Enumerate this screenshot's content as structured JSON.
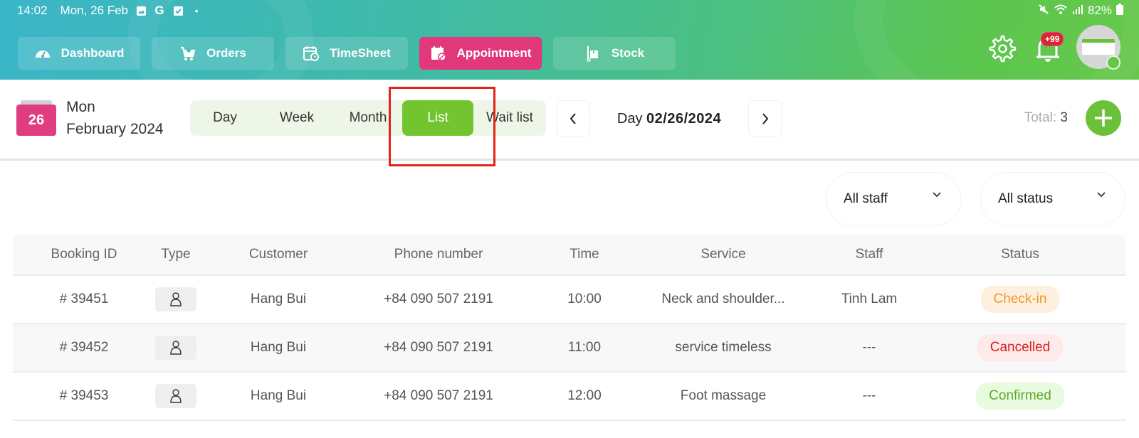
{
  "status_bar": {
    "time": "14:02",
    "date": "Mon, 26 Feb",
    "left_icons": [
      "image-icon",
      "google-icon",
      "checkbox-icon",
      "dot-icon"
    ],
    "right_icons": [
      "mute-icon",
      "wifi-icon",
      "signal-icon",
      "battery-icon"
    ],
    "battery": "82%"
  },
  "nav": {
    "items": [
      {
        "label": "Dashboard",
        "icon": "dashboard-gauge-icon",
        "active": false
      },
      {
        "label": "Orders",
        "icon": "cart-icon",
        "active": false
      },
      {
        "label": "TimeSheet",
        "icon": "calendar-clock-icon",
        "active": false
      },
      {
        "label": "Appointment",
        "icon": "calendar-check-icon",
        "active": true
      },
      {
        "label": "Stock",
        "icon": "hand-truck-icon",
        "active": false
      }
    ],
    "notification_badge": "+99"
  },
  "header": {
    "calendar_day": "26",
    "weekday": "Mon",
    "month_year": "February 2024",
    "view_tabs": [
      "Day",
      "Week",
      "Month",
      "List",
      "Wait list"
    ],
    "active_view": "List",
    "date_prefix": "Day",
    "date_value": "02/26/2024",
    "total_label": "Total:",
    "total_value": "3"
  },
  "filters": {
    "staff": "All staff",
    "status": "All status"
  },
  "table": {
    "columns": [
      "Booking ID",
      "Type",
      "Customer",
      "Phone number",
      "Time",
      "Service",
      "Staff",
      "Status"
    ],
    "rows": [
      {
        "id": "# 39451",
        "type": "person-icon",
        "customer": "Hang Bui",
        "phone": "+84 090 507 2191",
        "time": "10:00",
        "service": "Neck and shoulder...",
        "staff": "Tinh Lam",
        "status": "Check-in"
      },
      {
        "id": "# 39452",
        "type": "person-icon",
        "customer": "Hang Bui",
        "phone": "+84 090 507 2191",
        "time": "11:00",
        "service": "service timeless",
        "staff": "---",
        "status": "Cancelled"
      },
      {
        "id": "# 39453",
        "type": "person-icon",
        "customer": "Hang Bui",
        "phone": "+84 090 507 2191",
        "time": "12:00",
        "service": "Foot massage",
        "staff": "---",
        "status": "Confirmed"
      }
    ]
  },
  "colors": {
    "accent_pink": "#e0387a",
    "accent_green": "#72c52f",
    "checkin_text": "#f0962a",
    "checkin_bg": "#fdf0de",
    "cancelled_text": "#d91e1e",
    "cancelled_bg": "#fdeaea",
    "confirmed_text": "#5aa92c",
    "confirmed_bg": "#e9fbdf"
  }
}
